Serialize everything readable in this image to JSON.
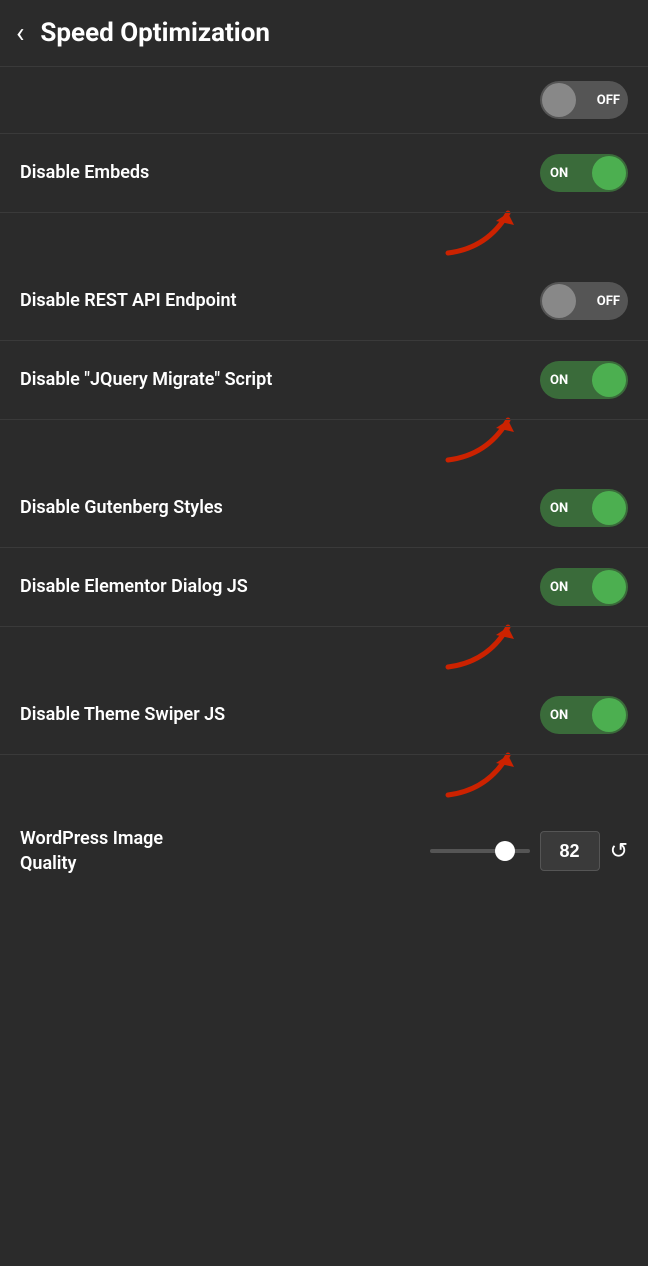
{
  "header": {
    "back_label": "‹",
    "title": "Speed Optimization"
  },
  "partial_row": {
    "label": "...",
    "toggle_state": "off"
  },
  "settings": [
    {
      "id": "disable-embeds",
      "label": "Disable Embeds",
      "state": "on",
      "has_arrow": true
    },
    {
      "id": "disable-rest-api",
      "label": "Disable REST API Endpoint",
      "state": "off",
      "has_arrow": false
    },
    {
      "id": "disable-jquery-migrate",
      "label": "Disable \"JQuery Migrate\" Script",
      "state": "on",
      "has_arrow": true
    },
    {
      "id": "disable-gutenberg-styles",
      "label": "Disable Gutenberg Styles",
      "state": "on",
      "has_arrow": false
    },
    {
      "id": "disable-elementor-dialog",
      "label": "Disable Elementor Dialog JS",
      "state": "on",
      "has_arrow": true
    },
    {
      "id": "disable-theme-swiper",
      "label": "Disable Theme Swiper JS",
      "state": "on",
      "has_arrow": true
    }
  ],
  "quality_row": {
    "label": "WordPress Image Quality",
    "value": "82",
    "slider_value": 82,
    "reset_icon": "↺"
  },
  "toggle_labels": {
    "on": "ON",
    "off": "OFF"
  }
}
